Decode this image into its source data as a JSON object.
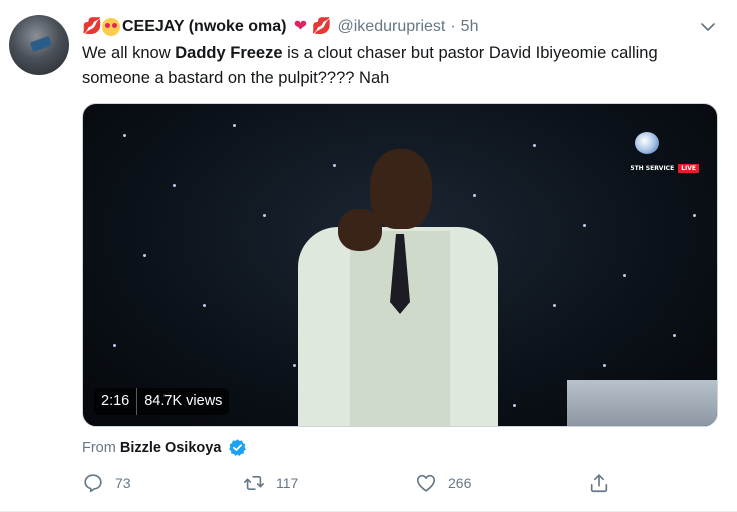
{
  "tweet": {
    "display_name": "CEEJAY (nwoke oma)",
    "handle": "@ikedurupriest",
    "separator": "·",
    "time": "5h",
    "text_before": "We all know ",
    "text_bold": "Daddy Freeze",
    "text_after": " is a clout chaser but pastor David Ibiyeomie calling someone a bastard on the pulpit???? Nah"
  },
  "video": {
    "duration": "2:16",
    "views": "84.7K views",
    "overlay_service": "5TH SERVICE",
    "overlay_live": "LIVE"
  },
  "source": {
    "from_label": "From",
    "source_name": "Bizzle Osikoya"
  },
  "actions": {
    "replies": "73",
    "retweets": "117",
    "likes": "266"
  },
  "icons": {
    "more": "chevron-down-icon",
    "reply": "reply-icon",
    "retweet": "retweet-icon",
    "like": "heart-icon",
    "share": "share-icon",
    "verified": "verified-badge-icon"
  },
  "colors": {
    "accent": "#1da1f2",
    "secondary_text": "#657786",
    "primary_text": "#14171a",
    "live_red": "#e0202a"
  }
}
